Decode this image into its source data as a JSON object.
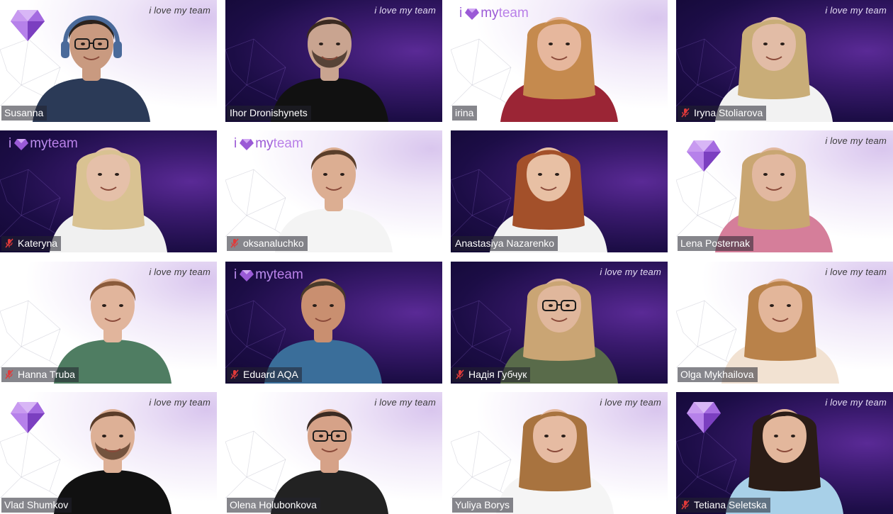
{
  "brand": {
    "tagline": "i love my team",
    "logo_i": "i",
    "logo_my": "my",
    "logo_team": "team",
    "accent": "#9b59d6",
    "mute_color": "#e03a3a"
  },
  "participants": [
    {
      "name": "Susanna",
      "muted": false,
      "theme": "light",
      "brand": "gem",
      "tagline": true,
      "skin": "#c99a80",
      "hair": "#2a211c",
      "shirt": "#2b3a57",
      "long_hair": false,
      "glasses": true,
      "headphones": true,
      "beard": false
    },
    {
      "name": "Ihor Dronishynets",
      "muted": false,
      "theme": "dark",
      "brand": "none",
      "tagline": true,
      "skin": "#c9a490",
      "hair": "#3b2a20",
      "shirt": "#111111",
      "long_hair": false,
      "glasses": false,
      "headphones": false,
      "beard": true
    },
    {
      "name": "irina",
      "muted": false,
      "theme": "light",
      "brand": "logo",
      "tagline": false,
      "skin": "#e6b79d",
      "hair": "#c58a4e",
      "shirt": "#9b2535",
      "long_hair": true,
      "glasses": false,
      "headphones": false,
      "beard": false
    },
    {
      "name": "Iryna Stoliarova",
      "muted": true,
      "theme": "dark",
      "brand": "none",
      "tagline": true,
      "skin": "#e2bca6",
      "hair": "#c9ad78",
      "shirt": "#f2f2f2",
      "long_hair": true,
      "glasses": false,
      "headphones": false,
      "beard": false
    },
    {
      "name": "Kateryna",
      "muted": true,
      "theme": "dark",
      "brand": "logo",
      "tagline": false,
      "skin": "#e5c0a9",
      "hair": "#d9c292",
      "shirt": "#f0f0f0",
      "long_hair": true,
      "glasses": false,
      "headphones": false,
      "beard": false
    },
    {
      "name": "oksanaluchko",
      "muted": true,
      "theme": "light",
      "brand": "logo",
      "tagline": false,
      "skin": "#dcae92",
      "hair": "#5a3e2a",
      "shirt": "#f4f4f4",
      "long_hair": false,
      "glasses": false,
      "headphones": false,
      "beard": false
    },
    {
      "name": "Anastasiya Nazarenko",
      "muted": false,
      "theme": "dark",
      "brand": "none",
      "tagline": false,
      "skin": "#e8c0a4",
      "hair": "#a3502a",
      "shirt": "#f2f2f2",
      "long_hair": true,
      "glasses": false,
      "headphones": false,
      "beard": false
    },
    {
      "name": "Lena Posternak",
      "muted": false,
      "theme": "light",
      "brand": "gem",
      "tagline": true,
      "skin": "#e2b8a0",
      "hair": "#c9a672",
      "shirt": "#d57e9a",
      "long_hair": true,
      "glasses": false,
      "headphones": false,
      "beard": false
    },
    {
      "name": "Hanna Truba",
      "muted": true,
      "theme": "light",
      "brand": "none",
      "tagline": true,
      "skin": "#e1b59c",
      "hair": "#8a5a3a",
      "shirt": "#4f7d62",
      "long_hair": false,
      "glasses": false,
      "headphones": false,
      "beard": false
    },
    {
      "name": "Eduard AQA",
      "muted": true,
      "theme": "dark",
      "brand": "logo",
      "tagline": false,
      "skin": "#c98f70",
      "hair": "#4a3a2a",
      "shirt": "#3a6e9a",
      "long_hair": false,
      "glasses": false,
      "headphones": false,
      "beard": false
    },
    {
      "name": "Надія Губчук",
      "muted": true,
      "theme": "dark",
      "brand": "none",
      "tagline": true,
      "skin": "#e0b79c",
      "hair": "#caa574",
      "shirt": "#596b4a",
      "long_hair": true,
      "glasses": true,
      "headphones": false,
      "beard": false
    },
    {
      "name": "Olga Mykhailova",
      "muted": false,
      "theme": "light",
      "brand": "none",
      "tagline": true,
      "skin": "#e3b69a",
      "hair": "#b9824a",
      "shirt": "#f2e2d2",
      "long_hair": true,
      "glasses": false,
      "headphones": false,
      "beard": false
    },
    {
      "name": "Vlad Shumkov",
      "muted": false,
      "theme": "light",
      "brand": "gem",
      "tagline": true,
      "skin": "#ddb096",
      "hair": "#5a3c28",
      "shirt": "#111111",
      "long_hair": false,
      "glasses": false,
      "headphones": false,
      "beard": true
    },
    {
      "name": "Olena Holubonkova",
      "muted": false,
      "theme": "light",
      "brand": "none",
      "tagline": true,
      "skin": "#d6a288",
      "hair": "#3a2a22",
      "shirt": "#222222",
      "long_hair": false,
      "glasses": true,
      "headphones": false,
      "beard": false
    },
    {
      "name": "Yuliya Borys",
      "muted": false,
      "theme": "light",
      "brand": "none",
      "tagline": true,
      "skin": "#e6bba2",
      "hair": "#a8733f",
      "shirt": "#f5f5f5",
      "long_hair": true,
      "glasses": false,
      "headphones": false,
      "beard": false
    },
    {
      "name": "Tetiana Seletska",
      "muted": true,
      "theme": "dark",
      "brand": "gem",
      "tagline": true,
      "skin": "#e3b79c",
      "hair": "#2a1c16",
      "shirt": "#a8d0e8",
      "long_hair": true,
      "glasses": false,
      "headphones": false,
      "beard": false
    }
  ]
}
